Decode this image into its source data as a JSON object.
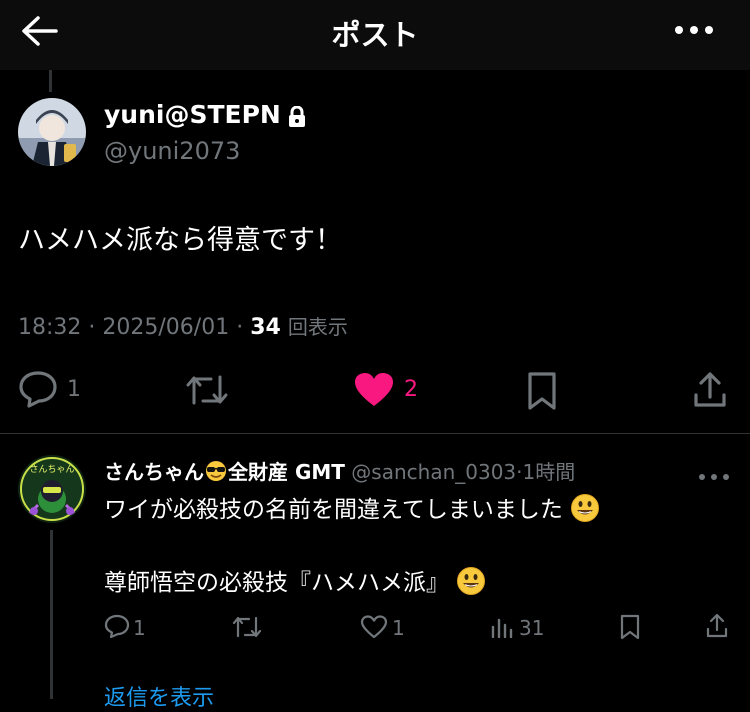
{
  "header": {
    "title": "ポスト",
    "back_icon": "arrow-left-icon",
    "more_icon": "more-horizontal-icon"
  },
  "tweet": {
    "display_name": "yuni@STEPN",
    "handle": "@yuni2073",
    "text": "ハメハメ派なら得意です！",
    "time": "18:32",
    "date": "2025/06/01",
    "views": "34",
    "views_label": "回表示",
    "actions": {
      "replies": "1",
      "likes": "2"
    }
  },
  "reply": {
    "display_name": "さんちゃん",
    "name_suffix": "全財産 GMT",
    "handle": "@sanchan_0303",
    "time": "1時間",
    "line1": "ワイが必殺技の名前を間違えてしまいました",
    "line2": "尊師悟空の必殺技『ハメハメ派』",
    "avatar_text": "さんちゃん",
    "actions": {
      "replies": "1",
      "likes": "1",
      "views": "31"
    }
  },
  "show_replies_label": "返信を表示",
  "colors": {
    "background": "#000000",
    "text": "#e7e9ea",
    "secondary": "#71767b",
    "like": "#f91880",
    "link": "#1d9bf0"
  }
}
